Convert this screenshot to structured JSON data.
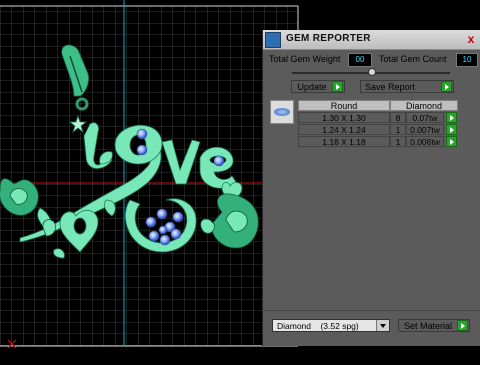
{
  "window": {
    "title": "GEM REPORTER",
    "close_label": "x"
  },
  "totals": {
    "weight_label": "Total Gem Weight",
    "weight_value": "00",
    "count_label": "Total Gem Count",
    "count_value": "10"
  },
  "actions": {
    "update_label": "Update",
    "save_report_label": "Save Report",
    "set_material_label": "Set Material"
  },
  "table": {
    "headers": [
      "Round",
      "Diamond"
    ],
    "rows": [
      {
        "size": "1.30 X 1.30",
        "count": "8",
        "weight": "0.07tw"
      },
      {
        "size": "1.24 X 1.24",
        "count": "1",
        "weight": "0.007tw"
      },
      {
        "size": "1.18 X 1.18",
        "count": "1",
        "weight": "0.006tw"
      }
    ]
  },
  "material": {
    "selected": "Diamond    (3.52 spg)"
  },
  "colors": {
    "panel_bg": "#5b5b5b",
    "model_green": "#79e8b8",
    "accent_green": "#2aa32a",
    "value_text": "#4fd0ff",
    "axis_red": "#c81010",
    "axis_blue": "#1aa6c8"
  },
  "icons": [
    "gem-reporter-icon",
    "close-icon",
    "play-arrow-icon",
    "gem-shape-icon",
    "dropdown-arrow-icon"
  ]
}
